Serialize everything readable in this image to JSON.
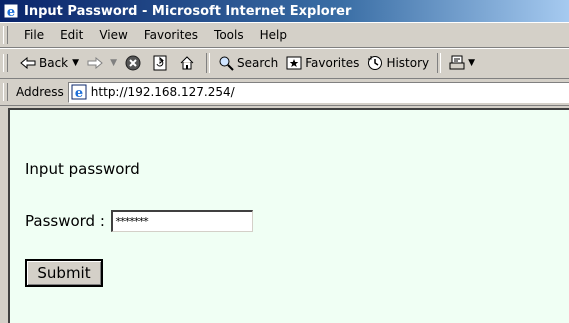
{
  "window": {
    "title": "Input Password - Microsoft Internet Explorer"
  },
  "menu": {
    "items": [
      "File",
      "Edit",
      "View",
      "Favorites",
      "Tools",
      "Help"
    ]
  },
  "toolbar": {
    "back_label": "Back",
    "search_label": "Search",
    "favorites_label": "Favorites",
    "history_label": "History",
    "icons": [
      "back-arrow-icon",
      "forward-arrow-icon",
      "stop-icon",
      "refresh-icon",
      "home-icon",
      "search-icon",
      "favorites-icon",
      "history-icon",
      "print-icon"
    ]
  },
  "address": {
    "label": "Address",
    "url": "http://192.168.127.254/"
  },
  "page": {
    "heading": "Input password",
    "password_label": "Password :",
    "password_value": "*******",
    "submit_label": "Submit"
  }
}
